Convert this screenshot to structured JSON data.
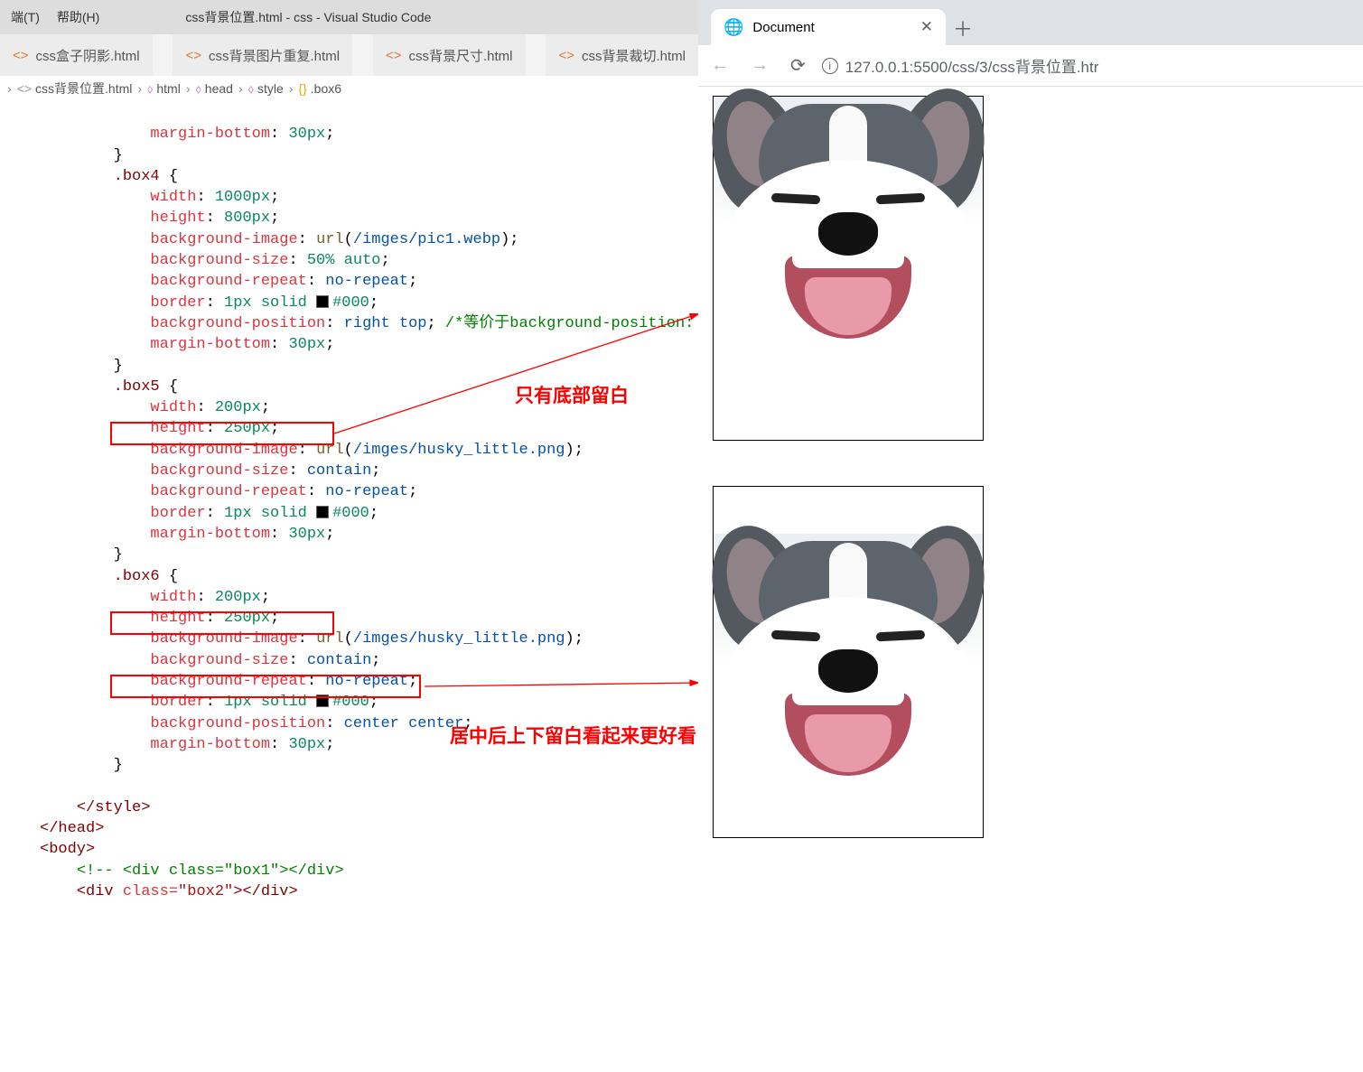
{
  "vscode": {
    "menus": [
      "端(T)",
      "帮助(H)"
    ],
    "window_title": "css背景位置.html - css - Visual Studio Code",
    "tabs": [
      "css盒子阴影.html",
      "css背景图片重复.html",
      "css背景尺寸.html",
      "css背景裁切.html"
    ],
    "breadcrumb": [
      "css背景位置.html",
      "html",
      "head",
      "style",
      ".box6"
    ],
    "code": {
      "l1a": "margin-bottom",
      "l1b": "30px",
      "l2": "}} ",
      "l3": ".box4 {",
      "l4a": "width",
      "l4b": "1000px",
      "l5a": "height",
      "l5b": "800px",
      "l6a": "background-image",
      "l6b": "url",
      "l6c": "/imges/pic1.webp",
      "l7a": "background-size",
      "l7b": "50% auto",
      "l8a": "background-repeat",
      "l8b": "no-repeat",
      "l9a": "border",
      "l9b": "1px solid",
      "l9c": "#000",
      "l10a": "background-position",
      "l10b": "right top",
      "l10c": "/*等价于background-position: top rig",
      "l11a": "margin-bottom",
      "l11b": "30px",
      "l12": "}",
      "l13": ".box5 {",
      "l14a": "width",
      "l14b": "200px",
      "l15a": "height",
      "l15b": "250px",
      "l16a": "background-image",
      "l16b": "url",
      "l16c": "/imges/husky_little.png",
      "l17a": "background-size",
      "l17b": "contain",
      "l18a": "background-repeat",
      "l18b": "no-repeat",
      "l19a": "border",
      "l19b": "1px solid",
      "l19c": "#000",
      "l20a": "margin-bottom",
      "l20b": "30px",
      "l21": "}",
      "l22": ".box6 {",
      "l23a": "width",
      "l23b": "200px",
      "l24a": "height",
      "l24b": "250px",
      "l25a": "background-image",
      "l25b": "url",
      "l25c": "/imges/husky_little.png",
      "l26a": "background-size",
      "l26b": "contain",
      "l27a": "background-repeat",
      "l27b": "no-repeat",
      "l28a": "border",
      "l28b": "1px solid",
      "l28c": "#000",
      "l29a": "background-position",
      "l29b": "center center",
      "l30a": "margin-bottom",
      "l30b": "30px",
      "l31": "}",
      "l33": "</style>",
      "l34": "</head>",
      "l35": "<body>",
      "l36": "<!-- <div class=\"box1\"></div>",
      "l37": "<div class=\"box2\"></div>"
    }
  },
  "annotations": {
    "a1": "只有底部留白",
    "a2": "居中后上下留白看起来更好看"
  },
  "browser": {
    "tab_title": "Document",
    "url": "127.0.0.1:5500/css/3/css背景位置.htr"
  }
}
